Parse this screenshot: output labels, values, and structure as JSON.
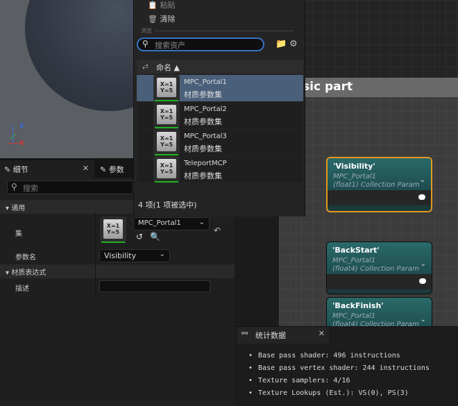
{
  "viewport": {
    "axis_z": "Z",
    "axis_x": "X"
  },
  "graph": {
    "comment_title": "sic part",
    "nodes": [
      {
        "title": "'Visibility'",
        "line1": "MPC_Portal1",
        "line2": "(float1) Collection Param"
      },
      {
        "title": "'BackStart'",
        "line1": "MPC_Portal1",
        "line2": "(float4) Collection Param"
      },
      {
        "title": "'BackFinish'",
        "line1": "MPC_Portal1",
        "line2": "(float4) Collection Param"
      }
    ]
  },
  "details": {
    "tab_details": "细节",
    "tab_params": "参数",
    "search_placeholder": "搜索",
    "section_general": "通用",
    "label_collection": "集",
    "collection_value": "MPC_Portal1",
    "label_param_name": "参数名",
    "param_name_value": "Visibility",
    "section_material_expr": "材质表达式",
    "label_desc": "描述",
    "thumb_text_1": "X=1",
    "thumb_text_2": "Y=5"
  },
  "picker": {
    "menu_paste": "粘贴",
    "menu_clear": "清除",
    "section_label": "浏览",
    "search_placeholder": "搜索资产",
    "column_name": "命名 ▲",
    "items": [
      {
        "name": "MPC_Portal1",
        "type": "材质参数集"
      },
      {
        "name": "MPC_Portal2",
        "type": "材质参数集"
      },
      {
        "name": "MPC_Portal3",
        "type": "材质参数集"
      },
      {
        "name": "TeleportMCP",
        "type": "材质参数集"
      }
    ],
    "footer": "4 项(1 项被选中)"
  },
  "stats": {
    "tab_label": "统计数据",
    "lines": [
      "Base pass shader: 496 instructions",
      "Base pass vertex shader: 244 instructions",
      "Texture samplers: 4/16",
      "Texture Lookups (Est.): VS(0), PS(3)"
    ]
  }
}
